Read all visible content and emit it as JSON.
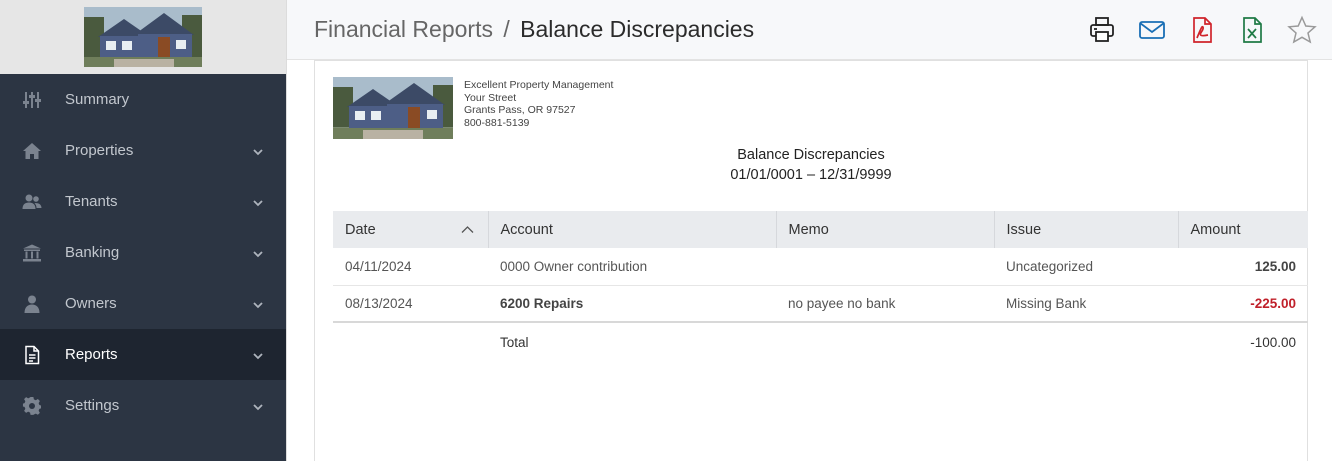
{
  "sidebar": {
    "items": [
      {
        "label": "Summary",
        "icon": "sliders-icon",
        "has_chevron": false
      },
      {
        "label": "Properties",
        "icon": "home-icon",
        "has_chevron": true
      },
      {
        "label": "Tenants",
        "icon": "users-icon",
        "has_chevron": true
      },
      {
        "label": "Banking",
        "icon": "bank-icon",
        "has_chevron": true
      },
      {
        "label": "Owners",
        "icon": "user-icon",
        "has_chevron": true
      },
      {
        "label": "Reports",
        "icon": "document-icon",
        "has_chevron": true,
        "active": true
      },
      {
        "label": "Settings",
        "icon": "gear-icon",
        "has_chevron": true
      }
    ]
  },
  "header": {
    "parent": "Financial Reports",
    "separator": "/",
    "current": "Balance Discrepancies",
    "tools": [
      "print-icon",
      "email-icon",
      "pdf-icon",
      "excel-icon",
      "star-icon"
    ]
  },
  "company": {
    "name": "Excellent Property Management",
    "street": "Your Street",
    "city": "Grants Pass, OR 97527",
    "phone": "800-881-5139"
  },
  "report": {
    "title": "Balance Discrepancies",
    "range": "01/01/0001 – 12/31/9999"
  },
  "table": {
    "columns": [
      "Date",
      "Account",
      "Memo",
      "Issue",
      "Amount"
    ],
    "rows": [
      {
        "date": "04/11/2024",
        "account": "0000 Owner contribution",
        "memo": "",
        "issue": "Uncategorized",
        "amount": "125.00"
      },
      {
        "date": "08/13/2024",
        "account": "6200 Repairs",
        "memo": "no payee no bank",
        "issue": "Missing Bank",
        "amount": "-225.00"
      }
    ],
    "total_label": "Total",
    "total_amount": "-100.00"
  },
  "colors": {
    "sidebar_bg": "#2c3543",
    "active_bg": "#1e2530",
    "email_icon": "#1a6fb5",
    "pdf_icon": "#d0242b",
    "excel_icon": "#1f7a45",
    "negative": "#c0202a"
  }
}
